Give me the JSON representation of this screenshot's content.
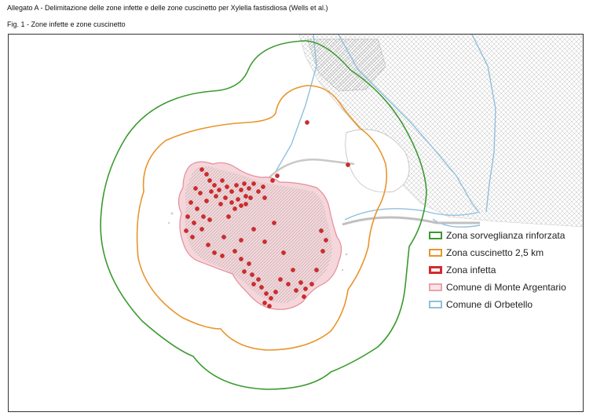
{
  "header": {
    "document_title": "Allegato A  - Delimitazione delle zone infette e delle zone cuscinetto per Xylella fastisdiosa (Wells et al.)",
    "figure_title": "Fig. 1 - Zone infette e zone cuscinetto"
  },
  "legend": {
    "items": [
      {
        "label": "Zona sorveglianza rinforzata",
        "color": "#3a9a2e",
        "style": "outline"
      },
      {
        "label": "Zona cuscinetto 2,5 km",
        "color": "#e8952c",
        "style": "outline"
      },
      {
        "label": "Zona infetta",
        "color": "#d42a2a",
        "style": "outline-thick"
      },
      {
        "label": "Comune di Monte Argentario",
        "color": "#e9a3ad",
        "style": "fill-pink"
      },
      {
        "label": "Comune di Orbetello",
        "color": "#8fc0dc",
        "style": "outline-blue"
      }
    ]
  },
  "colors": {
    "surveillance": "#3a9a2e",
    "buffer": "#e8952c",
    "infected": "#d42a2a",
    "monte_argentario": "#e9a3ad",
    "orbetello": "#8fc0dc"
  }
}
